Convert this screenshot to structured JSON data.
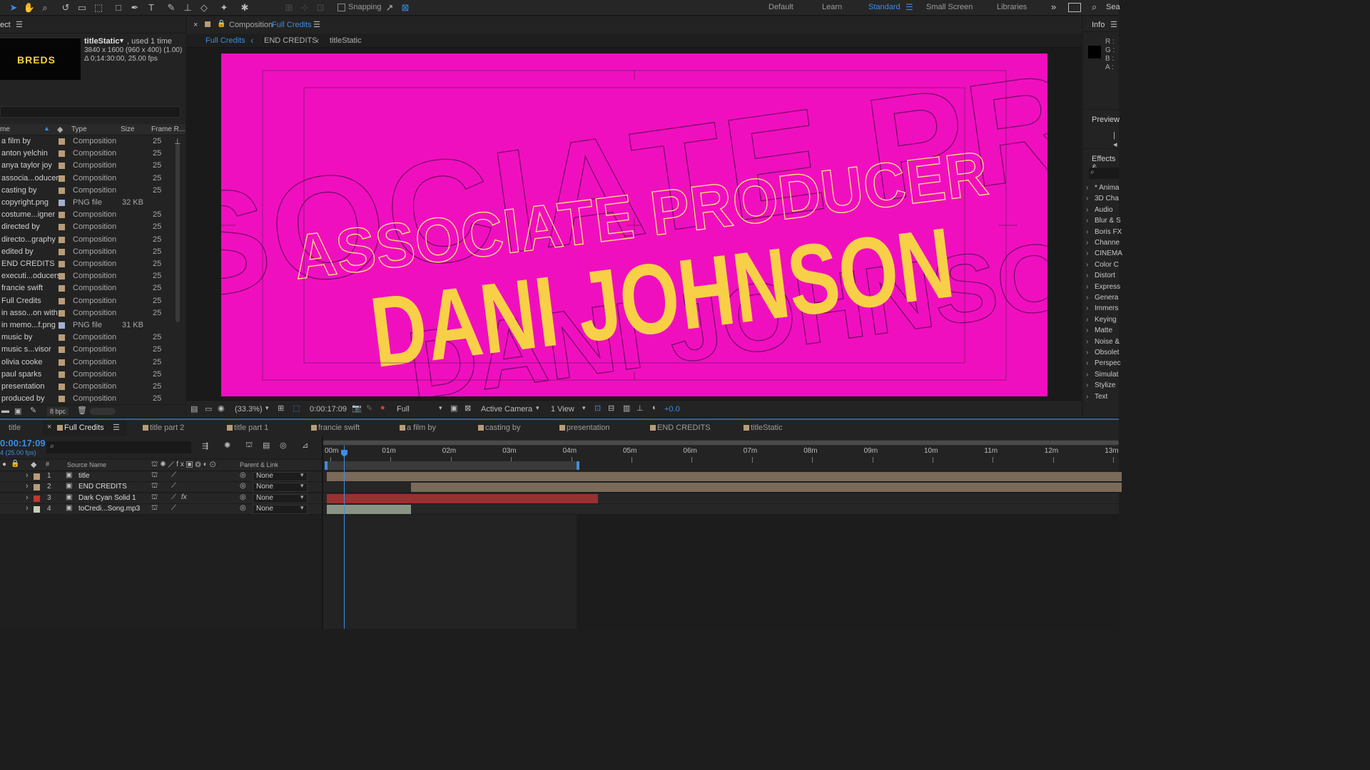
{
  "toolbar": {
    "snapping_label": "Snapping",
    "workspaces": [
      {
        "label": "Default",
        "active": false
      },
      {
        "label": "Learn",
        "active": false
      },
      {
        "label": "Standard",
        "active": true
      },
      {
        "label": "Small Screen",
        "active": false
      },
      {
        "label": "Libraries",
        "active": false
      }
    ],
    "search_label": "Sea"
  },
  "project_panel": {
    "title": "ect",
    "footage_name": "titleStatic",
    "footage_used": ", used 1 time",
    "footage_dims": "3840 x 1600  (960 x 400) (1.00)",
    "footage_duration": "Δ 0;14:30:00, 25.00 fps",
    "thumb_text": "BREDS",
    "columns": {
      "name": "me",
      "type": "Type",
      "size": "Size",
      "frame_rate": "Frame R..."
    },
    "items": [
      {
        "name": "a film by",
        "type": "Composition",
        "size": "",
        "fps": "25",
        "color": "#b89c78"
      },
      {
        "name": "anton yelchin",
        "type": "Composition",
        "size": "",
        "fps": "25",
        "color": "#b89c78"
      },
      {
        "name": "anya taylor joy",
        "type": "Composition",
        "size": "",
        "fps": "25",
        "color": "#b89c78"
      },
      {
        "name": "associa...oducer",
        "type": "Composition",
        "size": "",
        "fps": "25",
        "color": "#b89c78"
      },
      {
        "name": "casting by",
        "type": "Composition",
        "size": "",
        "fps": "25",
        "color": "#b89c78"
      },
      {
        "name": "copyright.png",
        "type": "PNG file",
        "size": "32 KB",
        "fps": "",
        "color": "#a6aed0"
      },
      {
        "name": "costume...igner",
        "type": "Composition",
        "size": "",
        "fps": "25",
        "color": "#b89c78"
      },
      {
        "name": "directed by",
        "type": "Composition",
        "size": "",
        "fps": "25",
        "color": "#b89c78"
      },
      {
        "name": "directo...graphy",
        "type": "Composition",
        "size": "",
        "fps": "25",
        "color": "#b89c78"
      },
      {
        "name": "edited by",
        "type": "Composition",
        "size": "",
        "fps": "25",
        "color": "#b89c78"
      },
      {
        "name": "END CREDITS",
        "type": "Composition",
        "size": "",
        "fps": "25",
        "color": "#b89c78"
      },
      {
        "name": "executi...oducers",
        "type": "Composition",
        "size": "",
        "fps": "25",
        "color": "#b89c78"
      },
      {
        "name": "francie swift",
        "type": "Composition",
        "size": "",
        "fps": "25",
        "color": "#b89c78"
      },
      {
        "name": "Full Credits",
        "type": "Composition",
        "size": "",
        "fps": "25",
        "color": "#b89c78"
      },
      {
        "name": "in asso...on with",
        "type": "Composition",
        "size": "",
        "fps": "25",
        "color": "#b89c78"
      },
      {
        "name": "in memo...f.png",
        "type": "PNG file",
        "size": "31 KB",
        "fps": "",
        "color": "#a6aed0"
      },
      {
        "name": "music by",
        "type": "Composition",
        "size": "",
        "fps": "25",
        "color": "#b89c78"
      },
      {
        "name": "music s...visor",
        "type": "Composition",
        "size": "",
        "fps": "25",
        "color": "#b89c78"
      },
      {
        "name": "olivia cooke",
        "type": "Composition",
        "size": "",
        "fps": "25",
        "color": "#b89c78"
      },
      {
        "name": "paul sparks",
        "type": "Composition",
        "size": "",
        "fps": "25",
        "color": "#b89c78"
      },
      {
        "name": "presentation",
        "type": "Composition",
        "size": "",
        "fps": "25",
        "color": "#b89c78"
      },
      {
        "name": "produced by",
        "type": "Composition",
        "size": "",
        "fps": "25",
        "color": "#b89c78"
      }
    ],
    "bpc_label": "8 bpc"
  },
  "composition_panel": {
    "tab_prefix": "Composition",
    "tab_name": "Full Credits",
    "breadcrumbs": [
      "Full Credits",
      "END CREDITS",
      "titleStatic"
    ],
    "canvas": {
      "background": "#f00fbf",
      "headline": "ASSOCIATE PRODUCER",
      "name": "DANI JOHNSON",
      "ghost_top": "SOCIATE PRODUC",
      "ghost_bottom": "DANI JOHNSON",
      "name_color": "#f8d047"
    },
    "footer": {
      "zoom": "(33.3%)",
      "timecode": "0:00:17:09",
      "resolution": "Full",
      "camera": "Active Camera",
      "views": "1 View",
      "exposure": "+0.0"
    }
  },
  "right_panels": {
    "info_title": "Info",
    "info_channels": [
      "R :",
      "G :",
      "B :",
      "A :"
    ],
    "preview_title": "Preview",
    "effects_title": "Effects &",
    "effects": [
      "* Anima",
      "3D Cha",
      "Audio",
      "Blur & S",
      "Boris FX",
      "Channe",
      "CINEMA",
      "Color C",
      "Distort",
      "Express",
      "Genera",
      "Immers",
      "Keying",
      "Matte",
      "Noise &",
      "Obsolet",
      "Perspec",
      "Simulat",
      "Stylize",
      "Text"
    ]
  },
  "timeline": {
    "tabs": [
      {
        "label": "title",
        "active": false
      },
      {
        "label": "Full Credits",
        "active": true
      },
      {
        "label": "title part 2",
        "active": false
      },
      {
        "label": "title part 1",
        "active": false
      },
      {
        "label": "francie swift",
        "active": false
      },
      {
        "label": "a film by",
        "active": false
      },
      {
        "label": "casting by",
        "active": false
      },
      {
        "label": "presentation",
        "active": false
      },
      {
        "label": "END CREDITS",
        "active": false
      },
      {
        "label": "titleStatic",
        "active": false
      }
    ],
    "timecode": "0:00:17:09",
    "frame_info": "4 (25.00 fps)",
    "columns": {
      "source_name": "Source Name",
      "parent_link": "Parent & Link"
    },
    "ruler_labels": [
      "00m",
      "01m",
      "02m",
      "03m",
      "04m",
      "05m",
      "06m",
      "07m",
      "08m",
      "09m",
      "10m",
      "11m",
      "12m",
      "13m"
    ],
    "layers": [
      {
        "num": "1",
        "name": "title",
        "parent": "None",
        "label_color": "#b89c78",
        "bar_color": "#7a6a5a",
        "bar_start_min": 0,
        "bar_end_min": 13.2
      },
      {
        "num": "2",
        "name": "END CREDITS",
        "parent": "None",
        "label_color": "#b89c78",
        "bar_color": "#7a6a5a",
        "bar_start_min": 1.4,
        "bar_end_min": 13.2
      },
      {
        "num": "3",
        "name": "Dark Cyan Solid 1",
        "parent": "None",
        "label_color": "#c0392b",
        "bar_color": "#9a3030",
        "bar_start_min": 0,
        "bar_end_min": 4.5
      },
      {
        "num": "4",
        "name": "toCredi...Song.mp3",
        "parent": "None",
        "label_color": "#c4cfb8",
        "bar_color": "#8a9484",
        "bar_start_min": 0,
        "bar_end_min": 1.4
      }
    ]
  }
}
